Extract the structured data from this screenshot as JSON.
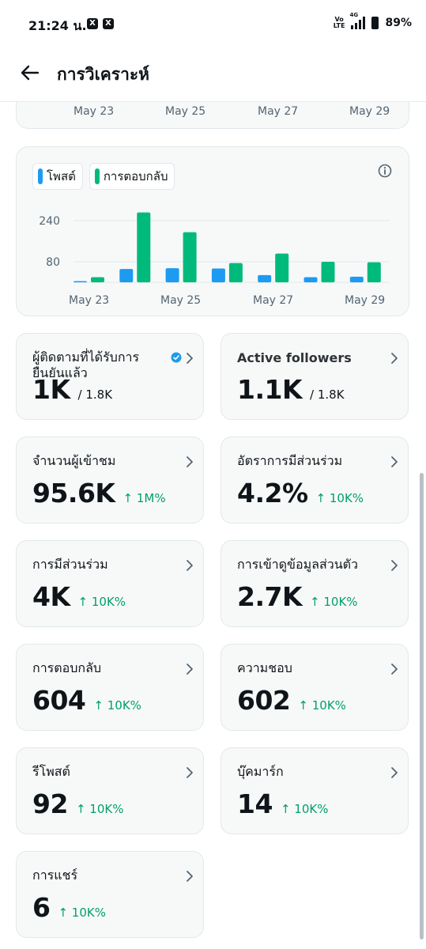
{
  "status_bar": {
    "time": "21:24 น.",
    "network": "4G",
    "volte_top": "Vo",
    "volte_bottom": "LTE",
    "battery": "89%",
    "notif_badge_1": "X",
    "notif_badge_2": "X"
  },
  "header": {
    "title": "การวิเคราะห์"
  },
  "top_card": {
    "x_labels": [
      "May 23",
      "May 25",
      "May 27",
      "May 29"
    ]
  },
  "chart": {
    "legend": [
      {
        "label": "โพสต์",
        "color": "#1d9bf0"
      },
      {
        "label": "การตอบกลับ",
        "color": "#00ba7c"
      }
    ],
    "y_tick_labels": [
      "240",
      "80"
    ],
    "x_labels": [
      "May 23",
      "May 25",
      "May 27",
      "May 29"
    ]
  },
  "chart_data": {
    "type": "bar",
    "categories": [
      "May 23",
      "May 24",
      "May 25",
      "May 26",
      "May 27",
      "May 28",
      "May 29"
    ],
    "series": [
      {
        "name": "โพสต์",
        "values": [
          2,
          52,
          55,
          54,
          28,
          20,
          22
        ]
      },
      {
        "name": "การตอบกลับ",
        "values": [
          20,
          272,
          195,
          75,
          112,
          80,
          78
        ]
      }
    ],
    "yticks": [
      80,
      240
    ],
    "ylim": [
      0,
      280
    ],
    "grid": true,
    "legend_position": "top-left"
  },
  "metrics": [
    {
      "label": "ผู้ติดตามที่ได้รับการยืนยันแล้ว",
      "value": "1K",
      "sub": "/ 1.8K",
      "verified": true
    },
    {
      "label": "Active followers",
      "value": "1.1K",
      "sub": "/ 1.8K"
    },
    {
      "label": "จำนวนผู้เข้าชม",
      "value": "95.6K",
      "change": "↑ 1M%"
    },
    {
      "label": "อัตราการมีส่วนร่วม",
      "value": "4.2%",
      "change": "↑ 10K%"
    },
    {
      "label": "การมีส่วนร่วม",
      "value": "4K",
      "change": "↑ 10K%"
    },
    {
      "label": "การเข้าดูข้อมูลส่วนตัว",
      "value": "2.7K",
      "change": "↑ 10K%"
    },
    {
      "label": "การตอบกลับ",
      "value": "604",
      "change": "↑ 10K%"
    },
    {
      "label": "ความชอบ",
      "value": "602",
      "change": "↑ 10K%"
    },
    {
      "label": "รีโพสต์",
      "value": "92",
      "change": "↑ 10K%"
    },
    {
      "label": "บุ๊คมาร์ก",
      "value": "14",
      "change": "↑ 10K%"
    },
    {
      "label": "การแชร์",
      "value": "6",
      "change": "↑ 10K%"
    }
  ],
  "colors": {
    "posts": "#1d9bf0",
    "replies": "#00ba7c",
    "positive_change": "#00a067"
  }
}
